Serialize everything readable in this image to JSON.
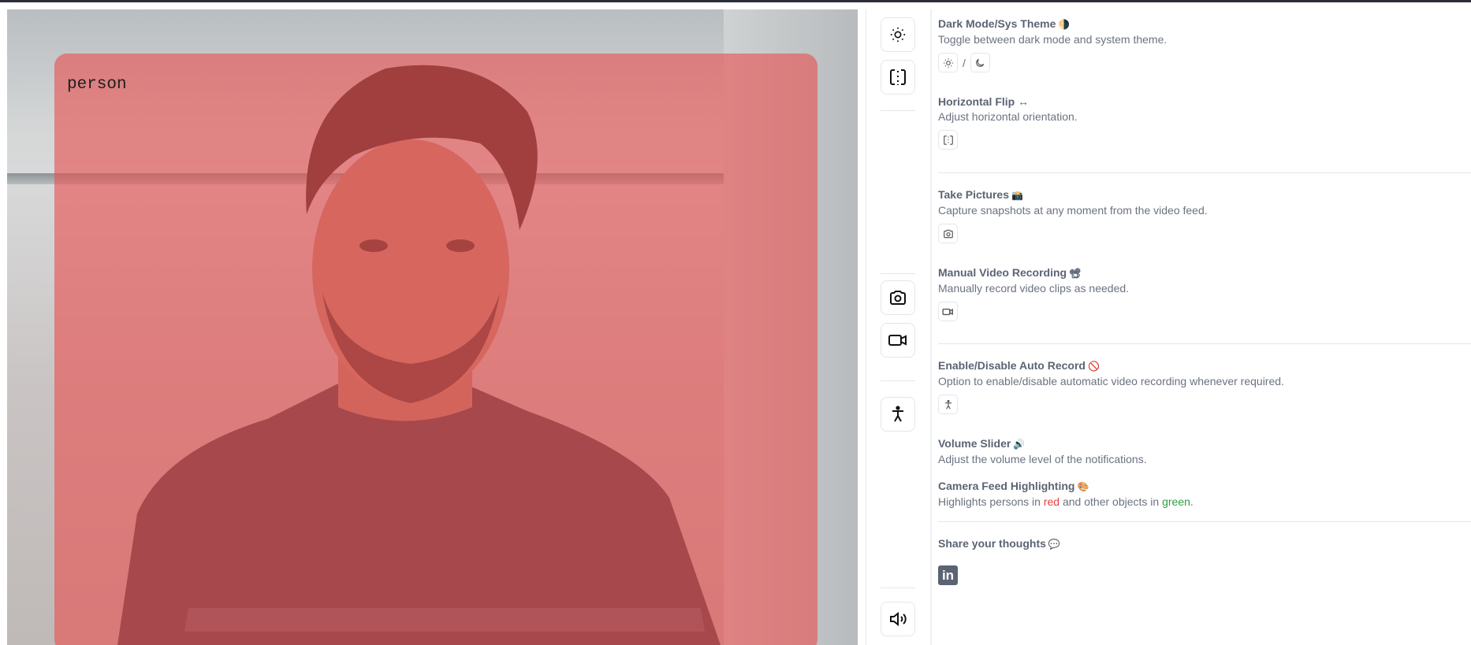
{
  "camera": {
    "detection_label": "person",
    "highlight_color": "#e85050"
  },
  "rail": {
    "icons": [
      "sun-icon",
      "flip-icon",
      "camera-icon",
      "video-icon",
      "accessibility-icon",
      "volume-icon"
    ]
  },
  "sections": {
    "theme": {
      "title": "Dark Mode/Sys Theme",
      "emoji": "🌗",
      "desc": "Toggle between dark mode and system theme.",
      "separator": "/"
    },
    "flip": {
      "title": "Horizontal Flip ↔",
      "desc": "Adjust horizontal orientation."
    },
    "pictures": {
      "title": "Take Pictures",
      "emoji": "📸",
      "desc": "Capture snapshots at any moment from the video feed."
    },
    "recording": {
      "title": "Manual Video Recording",
      "emoji": "📽",
      "desc": "Manually record video clips as needed."
    },
    "autorecord": {
      "title": "Enable/Disable Auto Record",
      "emoji": "🚫",
      "desc": "Option to enable/disable automatic video recording whenever required."
    },
    "volume": {
      "title": "Volume Slider",
      "emoji": "🔊",
      "desc": "Adjust the volume level of the notifications."
    },
    "highlighting": {
      "title": "Camera Feed Highlighting",
      "emoji": "🎨",
      "desc_before": "Highlights persons in ",
      "desc_red": "red",
      "desc_middle": " and other objects in ",
      "desc_green": "green",
      "desc_after": "."
    },
    "share": {
      "title": "Share your thoughts",
      "emoji": "💬",
      "linkedin_text": "in"
    }
  },
  "colors": {
    "red": "#e53e3e",
    "green": "#2f9e44",
    "heading": "#5b6474"
  }
}
